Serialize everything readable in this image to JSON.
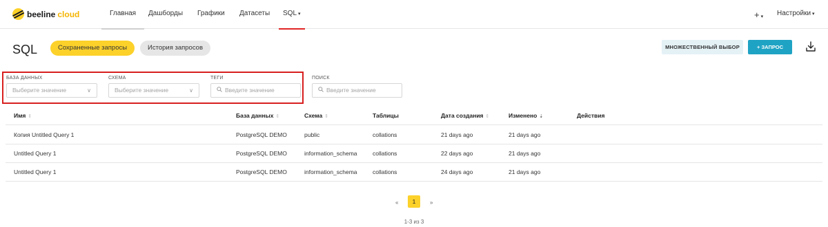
{
  "brand": {
    "name_part1": "beeline",
    "name_part2": "cloud"
  },
  "nav": {
    "items": [
      "Главная",
      "Дашборды",
      "Графики",
      "Датасеты",
      "SQL"
    ],
    "add_label": "+",
    "settings_label": "Настройки"
  },
  "page": {
    "title": "SQL",
    "tabs": [
      "Сохраненные запросы",
      "История запросов"
    ],
    "multi_select_label": "МНОЖЕСТВЕННЫЙ ВЫБОР",
    "add_query_label": "+ ЗАПРОС"
  },
  "filters": {
    "database": {
      "label": "БАЗА ДАННЫХ",
      "placeholder": "Выберите значение"
    },
    "schema": {
      "label": "СХЕМА",
      "placeholder": "Выберите значение"
    },
    "tags": {
      "label": "ТЕГИ",
      "placeholder": "Введите значение"
    },
    "search": {
      "label": "ПОИСК",
      "placeholder": "Введите значение"
    }
  },
  "table": {
    "columns": [
      "Имя",
      "База данных",
      "Схема",
      "Таблицы",
      "Дата создания",
      "Изменено",
      "Действия"
    ],
    "rows": [
      [
        "Копия Untitled Query 1",
        "PostgreSQL DEMO",
        "public",
        "collations",
        "21 days ago",
        "21 days ago"
      ],
      [
        "Untitled Query 1",
        "PostgreSQL DEMO",
        "information_schema",
        "collations",
        "22 days ago",
        "21 days ago"
      ],
      [
        "Untitled Query 1",
        "PostgreSQL DEMO",
        "information_schema",
        "collations",
        "24 days ago",
        "21 days ago"
      ]
    ]
  },
  "pagination": {
    "prev": "«",
    "current": "1",
    "next": "»",
    "summary": "1-3 из 3"
  },
  "colors": {
    "brand_yellow": "#fcd12a",
    "accent_blue": "#1fa3c4",
    "highlight_red": "#d81e1e"
  }
}
